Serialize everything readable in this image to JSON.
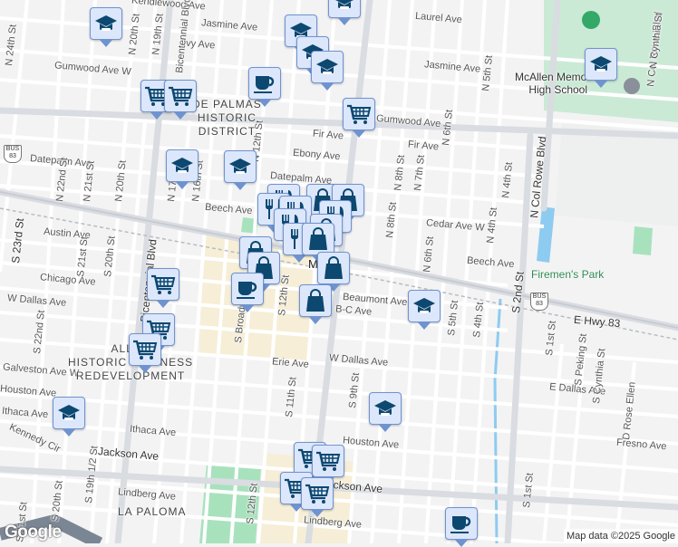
{
  "map": {
    "district_labels": [
      "DE PALMAS",
      "HISTORIC",
      "DISTRICT",
      "ALLEN",
      "HISTORIC BUSINESS",
      "REDEVELOPMENT",
      "LA PALOMA"
    ],
    "city_label": "McAllen",
    "poi_labels": [
      "McAllen Memorial",
      "High School",
      "Firemen's Park"
    ],
    "highway_shields": [
      "BUS",
      "83"
    ],
    "streets": [
      "Kendlewood Ave",
      "Laurel Ave",
      "Jasmine Ave",
      "Ivy Ave",
      "Jasmine Ave",
      "Gumwood Ave W",
      "Gumwood Ave",
      "Fir Ave",
      "Fir Ave",
      "Ebony Ave",
      "Datepalm Ave",
      "Datepalm Ave",
      "Cedar Ave W",
      "Beech Ave",
      "Beech Ave",
      "Austin Ave",
      "Chicago Ave",
      "W Dallas Ave",
      "Beaumont Ave",
      "B-C Ave",
      "Galveston Ave W",
      "Erie Ave",
      "W Dallas Ave",
      "Houston Ave",
      "Ithaca Ave",
      "Ithaca Ave",
      "Kennedy Cir",
      "Houston Ave",
      "Jackson Ave",
      "Jackson Ave",
      "Lindberg Ave",
      "Lindberg Ave",
      "E Hwy 83",
      "E Dallas Ave",
      "Fresno Ave",
      "Cedar Ave W",
      "Beaumont Ave"
    ],
    "vstreets": [
      "N 24th St",
      "N 20th St",
      "N 19th St",
      "Bicentennial Blvd",
      "Bicentennial Blvd",
      "N 17th St",
      "N 16th St",
      "N 12th St",
      "N 8th St",
      "N 7th St",
      "N 6th St",
      "N 5th St",
      "N 4th St",
      "N 4th St",
      "N 6th St",
      "N 8th St",
      "N Col Rowe Blvd",
      "N Col Rowe Blvd",
      "N Cynthia St",
      "S 23rd St",
      "N 22nd St",
      "N 21st St",
      "N 20th St",
      "S 21st St",
      "S 20th St",
      "S 22nd St",
      "S 12th St",
      "S Broadway",
      "S 11th St",
      "S 9th St",
      "S 5th St",
      "S 4th St",
      "S 2nd St",
      "S 1st St",
      "S Peking St",
      "S Cynthia St",
      "D Rose Ellen",
      "S 1st St",
      "S 20th St",
      "S 19th 1/2 St",
      "S 12th St",
      "S 21st St"
    ],
    "marker_types": [
      "school",
      "coffee",
      "grocery",
      "restaurant",
      "shopping"
    ],
    "colors": {
      "marker_fill": "#dce7fb",
      "marker_border": "#6f93cf",
      "icon": "#0c4870",
      "park": "#a8e2bd",
      "water": "#8ecbf0"
    }
  },
  "footer": {
    "logo": "Google",
    "attribution": "Map data ©2025 Google"
  }
}
